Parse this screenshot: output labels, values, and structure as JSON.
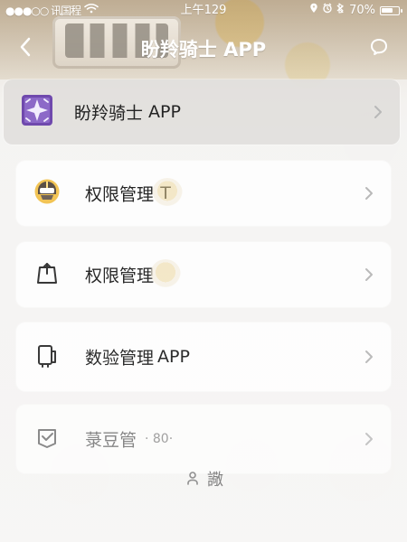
{
  "status_bar": {
    "carrier": "●●●○○ 讯国程",
    "time": "上午129",
    "battery": "70%",
    "battery_level": 0.7
  },
  "header": {
    "title": "盼羚骑士 APP"
  },
  "featured": {
    "title": "盼羚骑士",
    "tag": "APP"
  },
  "items": [
    {
      "label": "权限管理",
      "extra": "T"
    },
    {
      "label": "权限管理",
      "extra": ""
    },
    {
      "label": "数验管理",
      "extra": "APP"
    },
    {
      "label": "菉豆管",
      "extra": "· 80·"
    }
  ],
  "footer": {
    "text": "䜘"
  },
  "icons": {
    "back": "chevron-left-icon",
    "chat": "chat-bubble-icon",
    "featured": "sparkle-app-icon",
    "item_1": "helmet-icon",
    "item_2": "upload-bag-icon",
    "item_3": "data-device-icon",
    "item_4": "checked-box-icon",
    "footer": "user-icon"
  },
  "colors": {
    "primary_text": "#242424",
    "secondary_text": "#8a8a8a",
    "header_text": "#ffffff",
    "featured_bg": "#dfdcd9",
    "card_bg": "#ffffff",
    "purple_accent": "#7b55b8",
    "gold_accent": "#e2c26b"
  }
}
